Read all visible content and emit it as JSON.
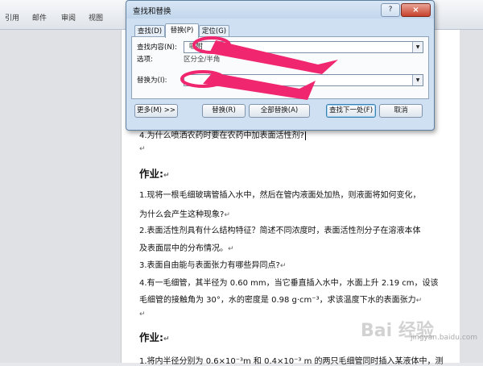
{
  "ribbon": {
    "tabs": [
      "引用",
      "邮件",
      "审阅",
      "视图"
    ]
  },
  "dialog": {
    "title": "查找和替换",
    "help": "?",
    "close": "×",
    "tabs": [
      "查找(D)",
      "替换(P)",
      "定位(G)"
    ],
    "find_label": "查找内容(N):",
    "find_value": "吸附",
    "options_label": "选项:",
    "options_value": "区分全/半角",
    "replace_label": "替换为(I):",
    "replace_value": "",
    "buttons": {
      "more": "更多(M) >>",
      "replace": "替换(R)",
      "replace_all": "全部替换(A)",
      "find_next": "查找下一处(F)",
      "cancel": "取消"
    }
  },
  "document": {
    "lines": [
      "4.为什么喷洒农药时要在农药中加表面活性剂?",
      "作业:",
      "1.现将一根毛细玻璃管插入水中，然后在管内液面处加热，则液面将如何变化，",
      "为什么会产生这种现象?",
      "2.表面活性剂具有什么结构特征？简述不同浓度时，表面活性剂分子在溶液本体",
      "及表面层中的分布情况。",
      "3.表面自由能与表面张力有哪些异同点?",
      "4.有一毛细管，其半径为 0.60 mm，当它垂直插入水中，水面上升 2.19 cm，设该",
      "毛细管的接触角为 30°，水的密度是 0.98 g·cm⁻³，求该温度下水的表面张力",
      "作业:",
      "1.将内半径分别为 0.6×10⁻³m 和 0.4×10⁻³ m 的两只毛细管同时插入某液体中，测"
    ],
    "para_mark": "↵"
  },
  "watermark": {
    "brand": "Bai 经验",
    "url": "jingyan.baidu.com"
  },
  "colors": {
    "arrow": "#f0266f"
  }
}
